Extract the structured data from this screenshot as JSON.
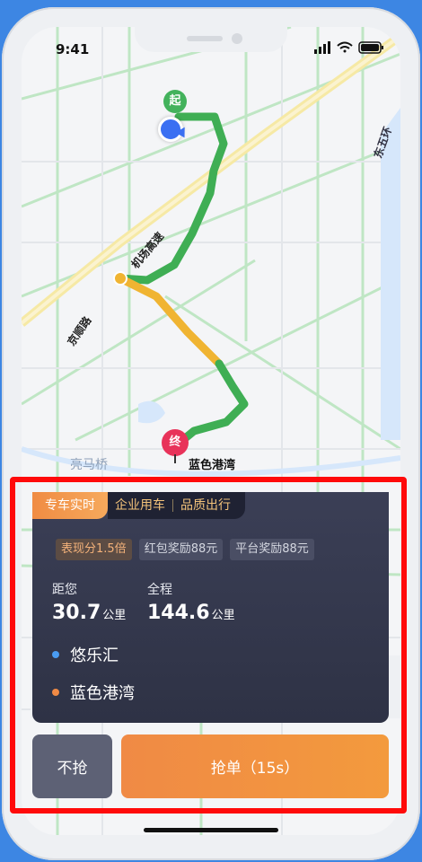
{
  "status_bar": {
    "time": "9:41"
  },
  "map": {
    "road_labels": [
      "机场高速",
      "京顺路",
      "东五环",
      "亮马桥"
    ],
    "start_marker": "起",
    "end_marker": "终",
    "destination_label": "蓝色港湾"
  },
  "order_card": {
    "tabs": [
      "专车实时",
      "企业用车",
      "品质出行"
    ],
    "badges": [
      "表现分1.5倍",
      "红包奖励88元",
      "平台奖励88元"
    ],
    "distance_to_you": {
      "label": "距您",
      "value": "30.7",
      "unit": "公里"
    },
    "total_distance": {
      "label": "全程",
      "value": "144.6",
      "unit": "公里"
    },
    "pickup": "悠乐汇",
    "dropoff": "蓝色港湾",
    "colors": {
      "pickup_dot": "#4a9cf2",
      "dropoff_dot": "#f08a45",
      "accent": "#f08c43"
    }
  },
  "actions": {
    "skip_label": "不抢",
    "grab_label": "抢单（15s）"
  }
}
